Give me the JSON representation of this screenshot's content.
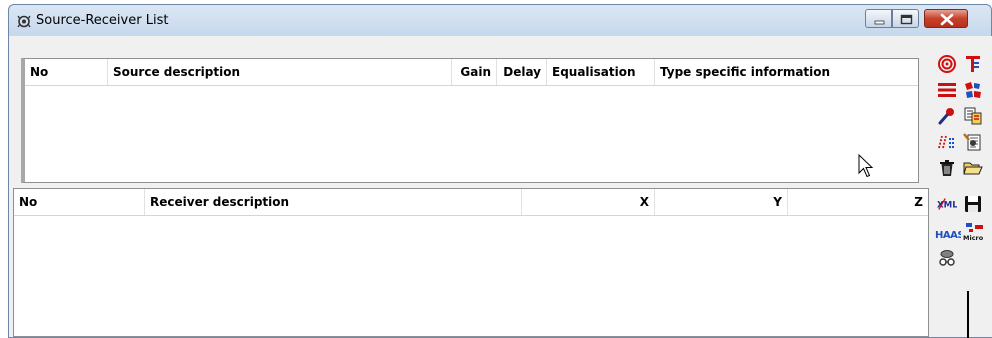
{
  "window": {
    "title": "Source-Receiver List"
  },
  "source_table": {
    "columns": [
      {
        "label": "No",
        "align": "left"
      },
      {
        "label": "Source description",
        "align": "left"
      },
      {
        "label": "Gain",
        "align": "right"
      },
      {
        "label": "Delay",
        "align": "right"
      },
      {
        "label": "Equalisation",
        "align": "left"
      },
      {
        "label": "Type specific information",
        "align": "left"
      }
    ],
    "rows": []
  },
  "receiver_table": {
    "columns": [
      {
        "label": "No",
        "align": "left"
      },
      {
        "label": "Receiver description",
        "align": "left"
      },
      {
        "label": "X",
        "align": "right"
      },
      {
        "label": "Y",
        "align": "right"
      },
      {
        "label": "Z",
        "align": "right"
      }
    ],
    "rows": []
  },
  "toolbar": {
    "icons": [
      "target-icon",
      "source-list-icon",
      "lines-icon",
      "grid-icon",
      "microphone-icon",
      "copy-icon",
      "dots-icon",
      "edit-icon",
      "trash-icon",
      "folder-open-icon",
      "xml-icon",
      "save-icon",
      "haas-icon",
      "micro-icon",
      "glasses-icon"
    ],
    "text": {
      "xml": "XML",
      "haas": "HAAS",
      "micro": "Micro"
    }
  },
  "colors": {
    "close": "#c7412c",
    "accent_red": "#d01010",
    "title_bg": "#c7d8ec"
  }
}
